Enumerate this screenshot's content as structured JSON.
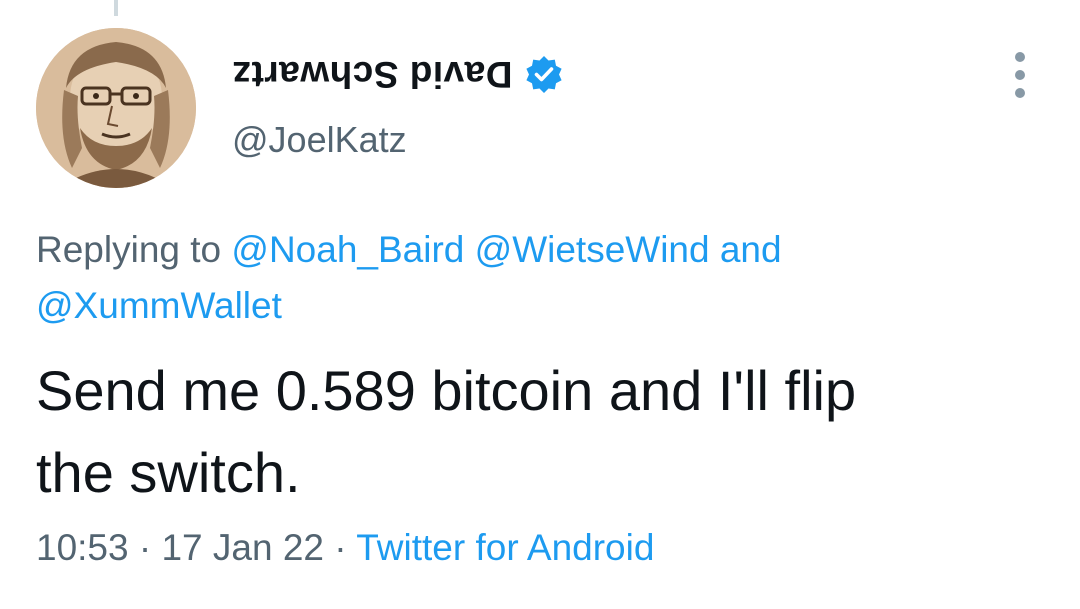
{
  "tweet": {
    "display_name": "David Schwartz",
    "handle": "@JoelKatz",
    "reply_prefix": "Replying to",
    "reply_mentions": [
      "@Noah_Baird",
      "@WietseWind",
      "@XummWallet"
    ],
    "reply_conjunction": "and",
    "text_line1": "Send me 0.589 bitcoin and I'll flip",
    "text_line2": "the switch.",
    "time": "10:53",
    "date": "17 Jan 22",
    "separator": "·",
    "source": "Twitter for Android"
  },
  "colors": {
    "link": "#1d9bf0",
    "secondary_text": "#536471",
    "primary_text": "#0f1419",
    "verified_badge": "#1d9bf0"
  },
  "icons": {
    "verified": "verified-badge-icon",
    "more": "more-options-icon",
    "avatar": "sketch-portrait"
  }
}
